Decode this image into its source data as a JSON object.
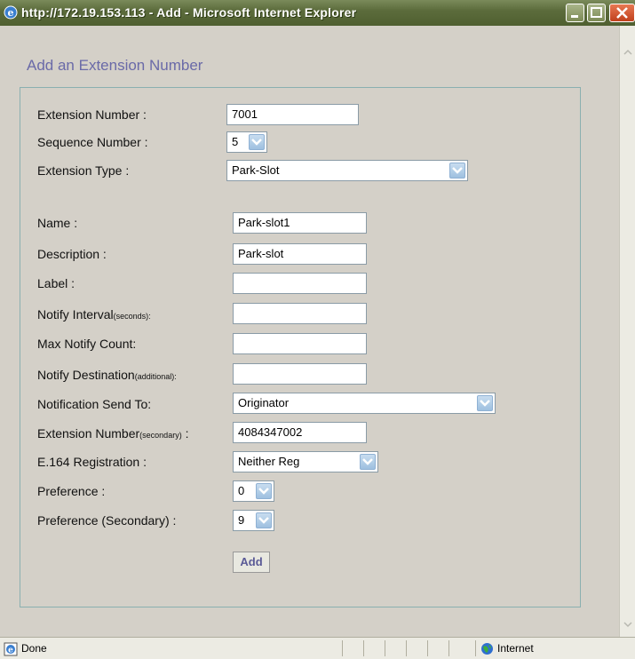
{
  "window": {
    "title": "http://172.19.153.113 - Add - Microsoft Internet Explorer"
  },
  "page": {
    "title": "Add an Extension Number"
  },
  "form": {
    "extension_number": {
      "label": "Extension Number :",
      "value": "7001"
    },
    "sequence_number": {
      "label": "Sequence Number :",
      "value": "5"
    },
    "extension_type": {
      "label": "Extension Type :",
      "value": "Park-Slot"
    },
    "name": {
      "label": "Name :",
      "value": "Park-slot1"
    },
    "description": {
      "label": "Description :",
      "value": "Park-slot"
    },
    "label": {
      "label": "Label :",
      "value": ""
    },
    "notify_interval": {
      "label": "Notify Interval",
      "label_suffix": "(seconds):",
      "value": ""
    },
    "max_notify_count": {
      "label": "Max Notify Count:",
      "value": ""
    },
    "notify_destination": {
      "label": "Notify Destination",
      "label_suffix": "(additional):",
      "value": ""
    },
    "notification_send_to": {
      "label": "Notification Send To:",
      "value": "Originator"
    },
    "extension_number_secondary": {
      "label": "Extension Number",
      "label_suffix": "(secondary)",
      "label_tail": " :",
      "value": "4084347002"
    },
    "e164_registration": {
      "label": "E.164 Registration :",
      "value": "Neither Reg"
    },
    "preference": {
      "label": "Preference :",
      "value": "0"
    },
    "preference_secondary": {
      "label": "Preference (Secondary) :",
      "value": "9"
    },
    "add_button": "Add"
  },
  "statusbar": {
    "status": "Done",
    "zone": "Internet"
  },
  "colors": {
    "titlebar": "#5c6c3c",
    "page_title": "#6a6aa8",
    "panel_border": "#8ab0b0",
    "background": "#d4d0c8"
  }
}
